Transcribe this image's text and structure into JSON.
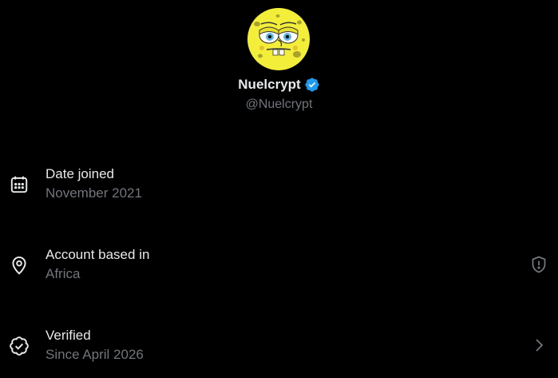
{
  "profile": {
    "display_name": "Nuelcrypt",
    "handle": "@Nuelcrypt",
    "avatar": "spongebob-avatar",
    "verified": true
  },
  "rows": [
    {
      "icon": "calendar-icon",
      "title": "Date joined",
      "subtitle": "November 2021"
    },
    {
      "icon": "location-pin-icon",
      "title": "Account based in",
      "subtitle": "Africa",
      "action_icon": "shield-alert-icon"
    },
    {
      "icon": "verified-badge-icon",
      "title": "Verified",
      "subtitle": "Since April 2026",
      "action_icon": "chevron-right-icon"
    }
  ],
  "colors": {
    "background": "#000000",
    "primary_text": "#e7e9ea",
    "secondary_text": "#71767b",
    "verified_blue": "#1d9bf0",
    "avatar_yellow": "#f5f23a"
  }
}
